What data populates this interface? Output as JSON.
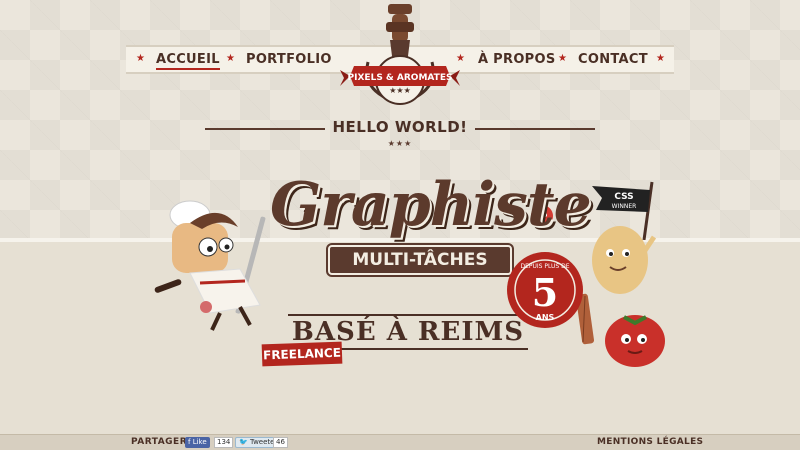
{
  "nav": {
    "items": [
      "ACCUEIL",
      "PORTFOLIO",
      "À PROPOS",
      "CONTACT"
    ],
    "active": "ACCUEIL"
  },
  "logo": {
    "text": "PIXELS & AROMATES"
  },
  "hero": {
    "greeting": "HELLO WORLD!",
    "title": "Graphiste",
    "subtitle": "MULTI-TÂCHES",
    "location": "BASÉ À REIMS",
    "tag": "FREELANCE",
    "badge": {
      "top": "DEPUIS PLUS DE",
      "number": "5",
      "bottom": "ANS"
    },
    "flag": {
      "line1": "CSS",
      "line2": "WINNER"
    }
  },
  "footer": {
    "share_label": "PARTAGER",
    "facebook": {
      "label": "Like",
      "count": "134"
    },
    "twitter": {
      "label": "Tweeter",
      "count": "46"
    },
    "legal": "MENTIONS LÉGALES"
  },
  "colors": {
    "brand_brown": "#4a2f25",
    "accent_red": "#b3261e",
    "paper": "#ebe6dc"
  }
}
